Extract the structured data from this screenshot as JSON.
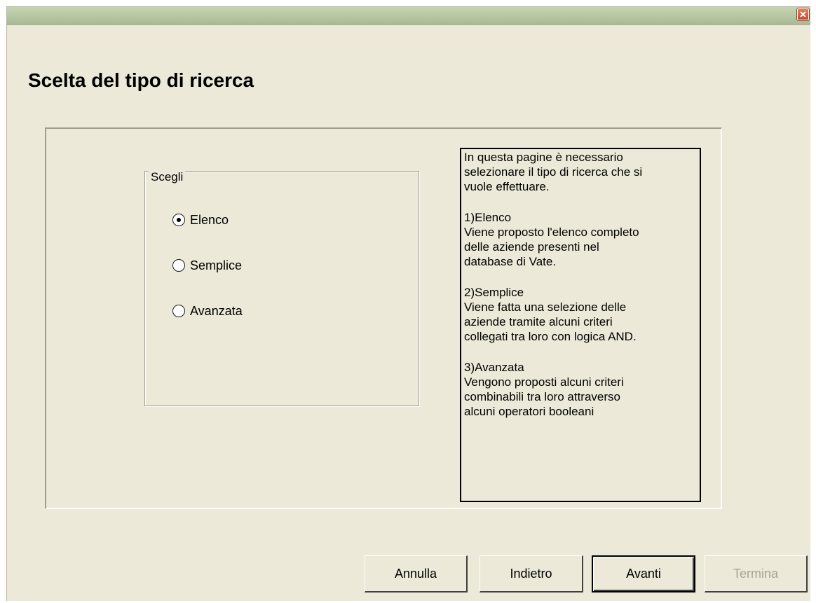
{
  "window": {
    "close_icon": "close-icon"
  },
  "page": {
    "title": "Scelta del tipo di ricerca"
  },
  "choice_group": {
    "legend": "Scegli",
    "selected": "Elenco",
    "options": [
      {
        "label": "Elenco",
        "checked": true
      },
      {
        "label": "Semplice",
        "checked": false
      },
      {
        "label": "Avanzata",
        "checked": false
      }
    ]
  },
  "info": {
    "paragraphs": [
      "In questa pagine è necessario\nselezionare il tipo  di ricerca che si\nvuole effettuare.",
      "1)Elenco\nViene proposto l'elenco completo\ndelle aziende presenti nel\ndatabase di Vate.",
      "2)Semplice\nViene fatta una selezione delle\naziende tramite alcuni criteri\ncollegati tra loro con logica AND.",
      "3)Avanzata\nVengono proposti alcuni criteri\ncombinabili tra loro attraverso\nalcuni operatori booleani"
    ]
  },
  "buttons": {
    "cancel": "Annulla",
    "back": "Indietro",
    "next": "Avanti",
    "finish": "Termina",
    "finish_enabled": false
  },
  "colors": {
    "dialog_bg": "#ece9d8",
    "titlebar": "#b8c8a3",
    "close_button": "#c8452a",
    "disabled_text": "#a7a498"
  }
}
